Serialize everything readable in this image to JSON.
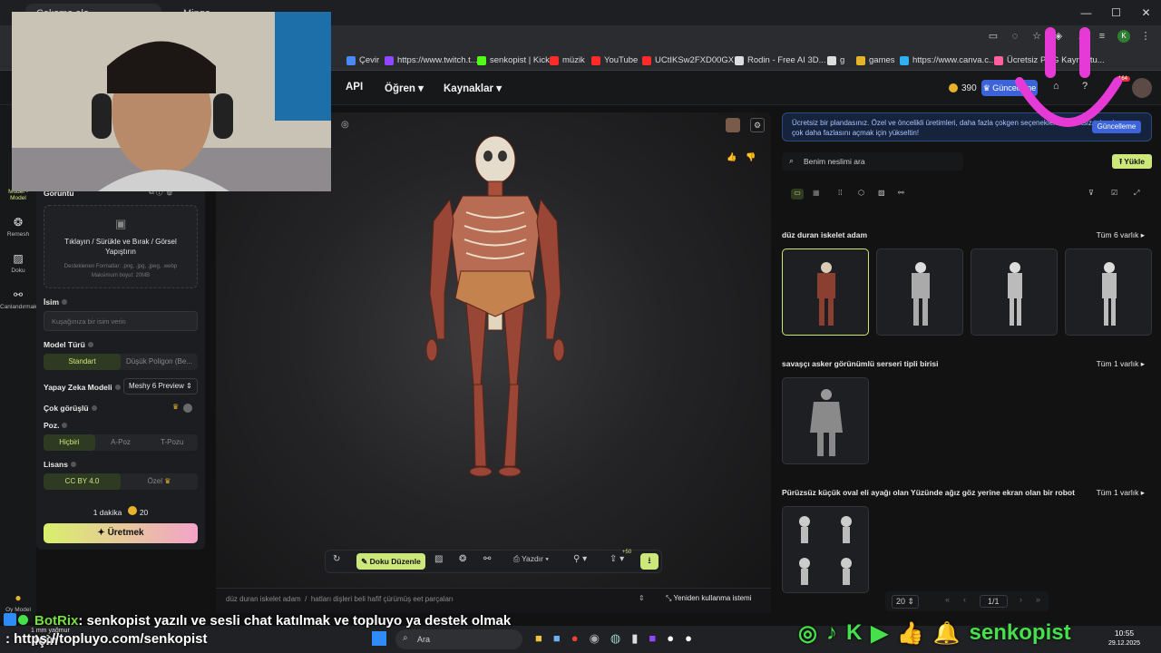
{
  "browser": {
    "tabs": [
      {
        "label": "Çalışma ala..."
      },
      {
        "label": "Mingo"
      }
    ],
    "window_controls": [
      "—",
      "☐",
      "✕"
    ],
    "profile_initial": "K",
    "bookmarks": [
      {
        "label": "Çevir",
        "color": "#4a8af4"
      },
      {
        "label": "https://www.twitch.t...",
        "color": "#9146ff"
      },
      {
        "label": "senkopist | Kick",
        "color": "#53fc18"
      },
      {
        "label": "müzik",
        "color": "#ff2a2a"
      },
      {
        "label": "YouTube",
        "color": "#ff2a2a"
      },
      {
        "label": "UCtIKSw2FXD00GX...",
        "color": "#ff2a2a"
      },
      {
        "label": "Rodin - Free AI 3D...",
        "color": "#dddddd"
      },
      {
        "label": "g",
        "color": "#dddddd"
      },
      {
        "label": "games",
        "color": "#e7b32a"
      },
      {
        "label": "https://www.canva.c...",
        "color": "#2fb0f2"
      },
      {
        "label": "Ücretsiz PNG Kaynaştu...",
        "color": "#ff5fa0"
      }
    ]
  },
  "header": {
    "nav": [
      "API",
      "Öğren",
      "Kaynaklar"
    ],
    "coins": "390",
    "upgrade_label": "Güncelleme",
    "notif_badge": "164"
  },
  "left_rail": {
    "items": [
      {
        "label": "Model - Model",
        "icon": "cube-icon"
      },
      {
        "label": "Remesh",
        "icon": "remesh-icon"
      },
      {
        "label": "Doku",
        "icon": "texture-icon"
      },
      {
        "label": "Canlandırmak",
        "icon": "animate-icon"
      },
      {
        "label": "Oy Model",
        "icon": "coin-icon"
      }
    ]
  },
  "left_panel": {
    "image_label": "Görüntü",
    "drop_title": "Tıklayın / Sürükle ve Bırak / Görsel Yapıştırın",
    "drop_formats": "Desteklenen Formatlar: .png, .jpg, .jpeg, .webp",
    "drop_maxsize": "Maksimum boyut: 20MB",
    "name_label": "İsim",
    "name_placeholder": "Kuşağınıza bir isim verin",
    "model_type_label": "Model Türü",
    "model_types": [
      "Standart",
      "Düşük Poligon (Be..."
    ],
    "ai_model_label": "Yapay Zeka Modeli",
    "ai_model_value": "Meshy 6 Preview",
    "multiview_label": "Çok görüşlü",
    "pose_label": "Poz.",
    "poses": [
      "Hiçbiri",
      "A-Poz",
      "T-Pozu"
    ],
    "license_label": "Lisans",
    "licenses": [
      "CC BY 4.0",
      "Özel"
    ],
    "duration": "1 dakika",
    "cost": "20",
    "generate_label": "Üretmek"
  },
  "viewer": {
    "toolbar_texture_label": "Doku Düzenle",
    "toolbar_print_label": "Yazdır",
    "toolbar_badge": "+50",
    "breadcrumb": [
      "düz duran iskelet adam",
      "hatları dişleri beli hafif çürümüş eet parçaları"
    ],
    "reuse_label": "Yeniden kullanma istemi"
  },
  "right_panel": {
    "notice": "Ücretsiz bir plandasınız. Özel ve öncelikli üretimleri, daha fazla çokgen seçeneklerini, ücretsiz tekrarları ve çok daha fazlasını açmak için yükseltin!",
    "notice_button": "Güncelleme",
    "search_placeholder": "Benim neslimi ara",
    "upload_label": "Yükle",
    "groups": [
      {
        "title": "düz duran iskelet adam",
        "all": "Tüm 6 varlık"
      },
      {
        "title": "savaşçı asker görünümlü serseri tipli birisi",
        "all": "Tüm 1 varlık"
      },
      {
        "title": "Pürüzsüz küçük oval eli ayağı olan Yüzünde ağız göz yerine ekran olan bir robot",
        "all": "Tüm 1 varlık"
      }
    ],
    "page_size": "20",
    "page": "1/1"
  },
  "stream": {
    "chat_user": "BotRix",
    "chat_text": ": senkopist yazılı ve sesli chat katılmak ve topluyo ya destek olmak için",
    "link_text": ": https://topluyo.com/senkopist",
    "channel": "senkopist",
    "weather": "1 mm yağmur"
  },
  "taskbar": {
    "search_placeholder": "Ara",
    "time": "10:55",
    "date": "29.12.2025"
  },
  "colors": {
    "accent_green": "#cde87a",
    "upgrade_blue": "#3d63d9",
    "overlay_green": "#46e04a",
    "overlay_pink": "#e63ad6"
  }
}
